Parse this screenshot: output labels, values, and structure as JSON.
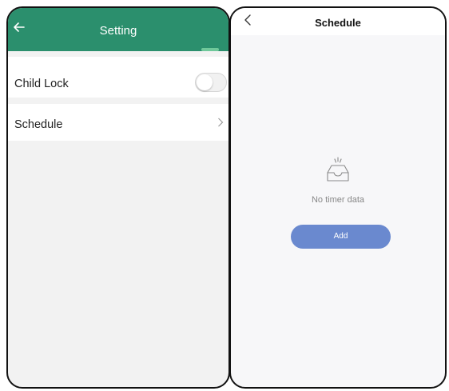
{
  "settings": {
    "title": "Setting",
    "child_lock_label": "Child Lock",
    "child_lock_on": false,
    "schedule_label": "Schedule",
    "header_color": "#2b8f6d"
  },
  "schedule": {
    "title": "Schedule",
    "empty_text": "No timer data",
    "add_label": "Add",
    "button_color": "#6a89cf"
  },
  "icons": {
    "back": "arrow-left-icon",
    "back_alt": "chevron-left-icon",
    "row_nav": "chevron-right-icon",
    "empty": "empty-inbox-icon"
  }
}
